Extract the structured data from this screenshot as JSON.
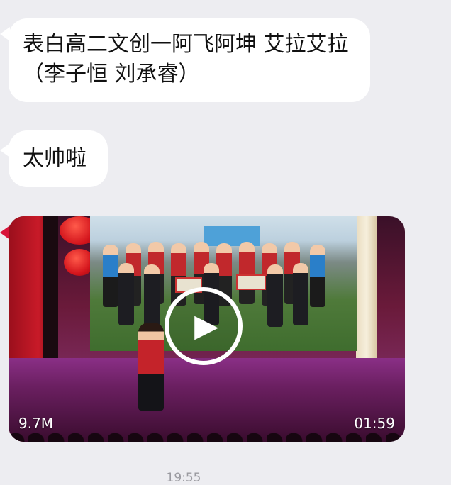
{
  "messages": [
    {
      "text": "表白高二文创一阿飞阿坤  艾拉艾拉（李子恒 刘承睿）"
    },
    {
      "text": "太帅啦"
    }
  ],
  "video": {
    "size": "9.7M",
    "duration": "01:59",
    "play_icon": "play-icon"
  },
  "timestamp": "19:55",
  "colors": {
    "background": "#ededf1",
    "bubble": "#ffffff",
    "timestamp": "#9a9aa0"
  }
}
